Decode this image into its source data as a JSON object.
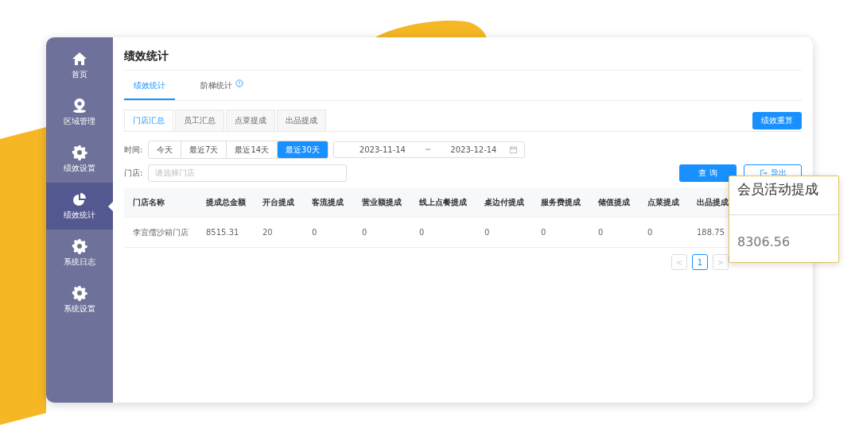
{
  "sidebar": {
    "items": [
      {
        "label": "首页",
        "selected": false
      },
      {
        "label": "区域管理",
        "selected": false
      },
      {
        "label": "绩效设置",
        "selected": false
      },
      {
        "label": "绩效统计",
        "selected": true
      },
      {
        "label": "系统日志",
        "selected": false
      },
      {
        "label": "系统设置",
        "selected": false
      }
    ]
  },
  "page_title": "绩效统计",
  "tabs": [
    {
      "label": "绩效统计",
      "selected": true,
      "info": false
    },
    {
      "label": "阶梯统计",
      "selected": false,
      "info": true
    }
  ],
  "subtabs": [
    {
      "label": "门店汇总",
      "selected": true
    },
    {
      "label": "员工汇总",
      "selected": false
    },
    {
      "label": "点菜提成",
      "selected": false
    },
    {
      "label": "出品提成",
      "selected": false
    }
  ],
  "recalc_button": "绩效重算",
  "time_filter": {
    "label": "时间:",
    "options": [
      {
        "label": "今天",
        "selected": false
      },
      {
        "label": "最近7天",
        "selected": false
      },
      {
        "label": "最近14天",
        "selected": false
      },
      {
        "label": "最近30天",
        "selected": true
      }
    ],
    "start": "2023-11-14",
    "separator": "~",
    "end": "2023-12-14"
  },
  "store_filter": {
    "label": "门店:",
    "placeholder": "请选择门店"
  },
  "query_button": "查 询",
  "export_button": "导出",
  "table": {
    "columns": [
      "门店名称",
      "提成总金额",
      "开台提成",
      "客流提成",
      "营业额提成",
      "线上点餐提成",
      "桌边付提成",
      "服务费提成",
      "储值提成",
      "点菜提成",
      "出品提成"
    ],
    "rows": [
      [
        "李宜儒沙箱门店",
        "8515.31",
        "20",
        "0",
        "0",
        "0",
        "0",
        "0",
        "0",
        "0",
        "188.75"
      ]
    ]
  },
  "pagination": {
    "prev": "<",
    "pages": [
      {
        "label": "1",
        "selected": true
      }
    ],
    "next": ">"
  },
  "callout": {
    "title": "会员活动提成",
    "value": "8306.56"
  }
}
